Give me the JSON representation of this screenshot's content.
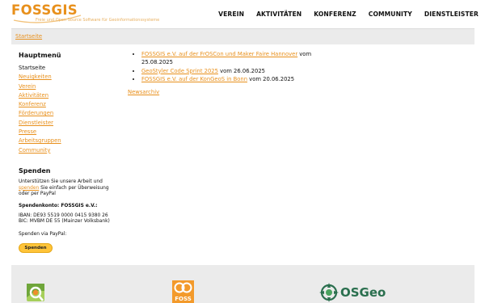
{
  "brand": {
    "name": "FOSSGIS",
    "tagline": "Freie und Open Source Software für Geoinformationssysteme",
    "color": "#e8901c"
  },
  "nav": [
    {
      "label": "Verein"
    },
    {
      "label": "Aktivitäten"
    },
    {
      "label": "Konferenz"
    },
    {
      "label": "Community"
    },
    {
      "label": "Dienstleister"
    }
  ],
  "breadcrumb": {
    "label": "Startseite"
  },
  "sidebar": {
    "title": "Hauptmenü",
    "items": [
      {
        "label": "Startseite"
      },
      {
        "label": "Neuigkeiten"
      },
      {
        "label": "Verein"
      },
      {
        "label": "Aktivitäten"
      },
      {
        "label": "Konferenz"
      },
      {
        "label": "Förderungen"
      },
      {
        "label": "Dienstleister"
      },
      {
        "label": "Presse"
      },
      {
        "label": "Arbeitsgruppen"
      },
      {
        "label": "Community"
      }
    ]
  },
  "donate": {
    "title": "Spenden",
    "text_before": "Unterstützen Sie unsere Arbeit und ",
    "link": "spenden",
    "text_after": " Sie einfach per Überweisung oder per PayPal",
    "account_title": "Spendenkonto: FOSSGIS e.V.:",
    "iban": "IBAN: DE93 5519 0000 0415 9380 26",
    "bic": "BIC: MVBM DE 55 (Mainzer Volksbank)",
    "paypal_label": "Spenden via PayPal:",
    "button_label": "Spenden"
  },
  "news": {
    "items": [
      {
        "title": "FOSSGIS e.V. auf der FrOSCon und Maker Faire Hannover",
        "suffix": " vom 25.08.2025"
      },
      {
        "title": "GeoStyler Code Sprint 2025",
        "suffix": " vom 26.06.2025"
      },
      {
        "title": "FOSSGIS e.V. auf der KonGeoS in Bonn",
        "suffix": " vom 20.06.2025"
      }
    ],
    "archive_label": "Newsarchiv"
  },
  "footer": {
    "logos": [
      {
        "name": "qgis-logo-icon"
      },
      {
        "name": "foss4g-logo-icon"
      },
      {
        "name": "osgeo-logo-icon",
        "text": "OSGeo"
      }
    ]
  }
}
